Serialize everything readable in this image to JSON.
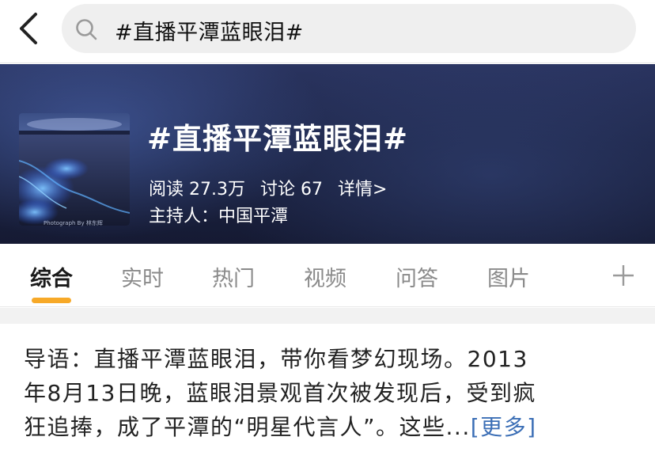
{
  "search": {
    "query": "#直播平潭蓝眼泪#"
  },
  "topic": {
    "title": "#直播平潭蓝眼泪#",
    "read_label": "阅读 27.3万",
    "discuss_label": "讨论 67",
    "details_label": "详情>",
    "host_label": "主持人：中国平潭",
    "thumbnail_caption": "Photograph By 林东辉"
  },
  "tabs": [
    {
      "label": "综合",
      "active": true
    },
    {
      "label": "实时",
      "active": false
    },
    {
      "label": "热门",
      "active": false
    },
    {
      "label": "视频",
      "active": false
    },
    {
      "label": "问答",
      "active": false
    },
    {
      "label": "图片",
      "active": false
    }
  ],
  "intro": {
    "lines": [
      "导语：直播平潭蓝眼泪，带你看梦幻现场。2013",
      "年8月13日晚，蓝眼泪景观首次被发现后，受到疯",
      "狂追捧，成了平潭的“明星代言人”。这些..."
    ],
    "more_label": "[更多]"
  },
  "colors": {
    "accent": "#f7a928",
    "link": "#3c6fb6",
    "header_bg": "#1d2546"
  },
  "icons": [
    "back-arrow-icon",
    "search-icon",
    "plus-icon"
  ]
}
